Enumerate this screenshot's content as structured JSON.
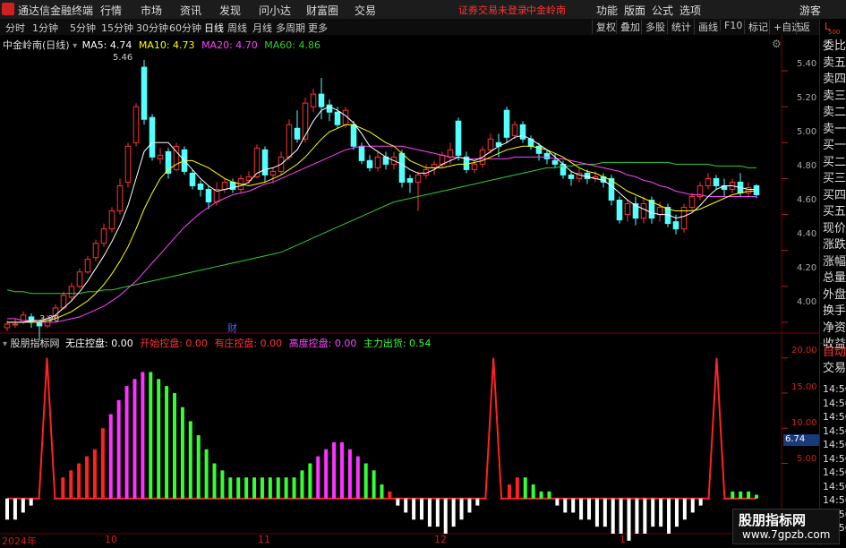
{
  "menubar": {
    "app_name": "通达信金融终端",
    "items": [
      "行情",
      "市场",
      "资讯",
      "发现",
      "问小达",
      "财富圈",
      "交易"
    ],
    "status": "证券交易未登录",
    "stock_tag": "中金岭南",
    "right_items": [
      "功能",
      "版面",
      "公式",
      "选项"
    ],
    "user": "游客"
  },
  "toolbar": {
    "periods": [
      "分时",
      "1分钟",
      "5分钟",
      "15分钟",
      "30分钟",
      "60分钟",
      "日线",
      "周线",
      "月线",
      "多周期",
      "更多"
    ],
    "active_period": "日线",
    "buttons": [
      "复权",
      "叠加",
      "多股",
      "统计",
      "画线",
      "F10",
      "标记",
      "+自选",
      "返回"
    ]
  },
  "sidebar": {
    "top_label": "L",
    "top_sub": "500",
    "items": [
      "委比",
      "卖五",
      "卖四",
      "卖三",
      "卖二",
      "卖一",
      "买一",
      "买二",
      "买三",
      "买四",
      "买五",
      "现价",
      "涨跌",
      "涨幅",
      "总量",
      "外盘",
      "换手",
      "净资",
      "收益"
    ],
    "lower_items": [
      "自动",
      "交易"
    ],
    "time_items": [
      "14:56",
      "14:56",
      "14:56",
      "14:56",
      "14:56",
      "14:56",
      "14:56",
      "14:56",
      "14:56",
      "14:56",
      "14:56"
    ]
  },
  "kline_legend": {
    "title": "中金岭南(日线)",
    "ma5": "MA5: 4.74",
    "ma10": "MA10: 4.73",
    "ma20": "MA20: 4.70",
    "ma60": "MA60: 4.86"
  },
  "indicator_legend": {
    "title": "股朋指标网",
    "items": [
      {
        "label": "无庄控盘: 0.00",
        "color": "#ffffff"
      },
      {
        "label": "开始控盘: 0.00",
        "color": "#ff3333"
      },
      {
        "label": "有庄控盘: 0.00",
        "color": "#ff3333"
      },
      {
        "label": "高度控盘: 0.00",
        "color": "#ff44ff"
      },
      {
        "label": "主力出货: 0.54",
        "color": "#33ff33"
      }
    ]
  },
  "price_axis": [
    "5.40",
    "5.20",
    "5.00",
    "4.80",
    "4.60",
    "4.40",
    "4.20",
    "4.00"
  ],
  "indicator_axis": [
    "20.00",
    "15.00",
    "10.00",
    "5.00"
  ],
  "indicator_current": "6.74",
  "annotations": {
    "high": "5.46",
    "low": "3.90",
    "finance_mark": "财"
  },
  "time_axis": [
    "2024年",
    "10",
    "11",
    "12",
    "1"
  ],
  "watermark": {
    "title": "股朋指标网",
    "url": "www.7gpzb.com"
  },
  "colors": {
    "up": "#ff3333",
    "down": "#54ffff",
    "ma5": "#ffffff",
    "ma10": "#ffff00",
    "ma20": "#ff44ff",
    "ma60": "#33cc33",
    "bg": "#000000"
  },
  "chart_data": {
    "type": "candlestick",
    "ylim": [
      3.9,
      5.5
    ],
    "candles": [
      [
        3.97,
        3.99,
        3.95,
        4.01
      ],
      [
        3.99,
        3.99,
        3.97,
        4.02
      ],
      [
        4.0,
        4.04,
        3.99,
        4.06
      ],
      [
        4.03,
        4.0,
        3.97,
        4.05
      ],
      [
        4.0,
        3.98,
        3.9,
        4.01
      ],
      [
        3.98,
        4.02,
        3.97,
        4.04
      ],
      [
        4.03,
        4.08,
        4.02,
        4.1
      ],
      [
        4.08,
        4.15,
        4.07,
        4.17
      ],
      [
        4.14,
        4.2,
        4.12,
        4.22
      ],
      [
        4.2,
        4.28,
        4.19,
        4.3
      ],
      [
        4.28,
        4.35,
        4.27,
        4.37
      ],
      [
        4.36,
        4.44,
        4.34,
        4.46
      ],
      [
        4.44,
        4.52,
        4.42,
        4.55
      ],
      [
        4.52,
        4.62,
        4.5,
        4.64
      ],
      [
        4.62,
        4.76,
        4.6,
        4.8
      ],
      [
        4.78,
        4.98,
        4.75,
        5.0
      ],
      [
        5.0,
        5.2,
        4.98,
        5.22
      ],
      [
        5.42,
        5.13,
        5.1,
        5.46
      ],
      [
        5.14,
        4.92,
        4.9,
        5.16
      ],
      [
        4.91,
        4.93,
        4.88,
        4.97
      ],
      [
        4.95,
        4.83,
        4.8,
        4.97
      ],
      [
        4.85,
        4.98,
        4.84,
        5.0
      ],
      [
        4.96,
        4.84,
        4.82,
        4.98
      ],
      [
        4.83,
        4.76,
        4.74,
        4.85
      ],
      [
        4.77,
        4.74,
        4.7,
        4.79
      ],
      [
        4.74,
        4.67,
        4.63,
        4.76
      ],
      [
        4.67,
        4.74,
        4.65,
        4.78
      ],
      [
        4.74,
        4.78,
        4.72,
        4.8
      ],
      [
        4.78,
        4.74,
        4.72,
        4.8
      ],
      [
        4.74,
        4.8,
        4.72,
        4.82
      ],
      [
        4.79,
        4.81,
        4.77,
        4.84
      ],
      [
        4.81,
        4.97,
        4.8,
        4.99
      ],
      [
        4.96,
        4.82,
        4.78,
        4.98
      ],
      [
        4.82,
        4.84,
        4.78,
        4.86
      ],
      [
        4.84,
        4.92,
        4.82,
        4.95
      ],
      [
        4.92,
        5.1,
        4.9,
        5.13
      ],
      [
        5.08,
        5.02,
        5.0,
        5.18
      ],
      [
        5.02,
        5.22,
        5.0,
        5.25
      ],
      [
        5.2,
        5.27,
        5.17,
        5.3
      ],
      [
        5.27,
        5.2,
        5.13,
        5.36
      ],
      [
        5.21,
        5.17,
        5.12,
        5.24
      ],
      [
        5.17,
        5.1,
        5.08,
        5.2
      ],
      [
        5.1,
        5.18,
        5.08,
        5.2
      ],
      [
        5.1,
        4.98,
        4.96,
        5.12
      ],
      [
        4.98,
        4.9,
        4.88,
        5.0
      ],
      [
        4.9,
        4.86,
        4.84,
        4.93
      ],
      [
        4.86,
        4.92,
        4.84,
        4.95
      ],
      [
        4.92,
        4.88,
        4.85,
        4.95
      ],
      [
        4.88,
        4.92,
        4.85,
        4.95
      ],
      [
        4.94,
        4.78,
        4.75,
        4.96
      ],
      [
        4.8,
        4.78,
        4.72,
        4.82
      ],
      [
        4.78,
        4.82,
        4.62,
        4.84
      ],
      [
        4.82,
        4.85,
        4.8,
        4.88
      ],
      [
        4.86,
        4.88,
        4.82,
        4.9
      ],
      [
        4.88,
        4.93,
        4.86,
        4.95
      ],
      [
        4.92,
        4.96,
        4.88,
        5.0
      ],
      [
        5.12,
        4.93,
        4.9,
        5.14
      ],
      [
        4.92,
        4.85,
        4.83,
        4.95
      ],
      [
        4.85,
        4.88,
        4.83,
        4.9
      ],
      [
        4.88,
        4.96,
        4.86,
        4.98
      ],
      [
        4.96,
        5.02,
        4.94,
        5.05
      ],
      [
        5.0,
        4.98,
        4.92,
        5.05
      ],
      [
        5.18,
        5.03,
        5.0,
        5.2
      ],
      [
        5.04,
        5.1,
        5.02,
        5.12
      ],
      [
        5.1,
        5.02,
        5.0,
        5.12
      ],
      [
        5.02,
        4.98,
        4.96,
        5.04
      ],
      [
        4.98,
        4.94,
        4.9,
        5.0
      ],
      [
        4.94,
        4.91,
        4.88,
        4.96
      ],
      [
        4.9,
        4.88,
        4.86,
        4.94
      ],
      [
        4.88,
        4.82,
        4.8,
        4.9
      ],
      [
        4.82,
        4.8,
        4.76,
        4.84
      ],
      [
        4.8,
        4.83,
        4.78,
        4.86
      ],
      [
        4.83,
        4.8,
        4.77,
        4.85
      ],
      [
        4.8,
        4.81,
        4.78,
        4.84
      ],
      [
        4.81,
        4.78,
        4.75,
        4.83
      ],
      [
        4.8,
        4.68,
        4.65,
        4.82
      ],
      [
        4.68,
        4.57,
        4.55,
        4.7
      ],
      [
        4.6,
        4.66,
        4.56,
        4.68
      ],
      [
        4.66,
        4.58,
        4.54,
        4.7
      ],
      [
        4.58,
        4.66,
        4.55,
        4.7
      ],
      [
        4.68,
        4.58,
        4.55,
        4.7
      ],
      [
        4.6,
        4.64,
        4.56,
        4.67
      ],
      [
        4.64,
        4.55,
        4.53,
        4.66
      ],
      [
        4.56,
        4.52,
        4.49,
        4.6
      ],
      [
        4.52,
        4.64,
        4.5,
        4.66
      ],
      [
        4.64,
        4.7,
        4.62,
        4.72
      ],
      [
        4.7,
        4.76,
        4.68,
        4.78
      ],
      [
        4.76,
        4.8,
        4.74,
        4.83
      ],
      [
        4.8,
        4.76,
        4.74,
        4.82
      ],
      [
        4.76,
        4.74,
        4.7,
        4.8
      ],
      [
        4.74,
        4.78,
        4.72,
        4.8
      ],
      [
        4.78,
        4.72,
        4.7,
        4.83
      ],
      [
        4.72,
        4.75,
        4.7,
        4.78
      ],
      [
        4.76,
        4.71,
        4.69,
        4.77
      ]
    ],
    "ma5": [
      4.0,
      4.0,
      4.0,
      4.01,
      4.01,
      4.02,
      4.04,
      4.08,
      4.12,
      4.17,
      4.23,
      4.3,
      4.37,
      4.45,
      4.54,
      4.65,
      4.8,
      4.95,
      5.0,
      5.0,
      5.0,
      4.95,
      4.9,
      4.85,
      4.8,
      4.76,
      4.73,
      4.74,
      4.75,
      4.76,
      4.78,
      4.83,
      4.85,
      4.86,
      4.88,
      4.92,
      4.96,
      5.04,
      5.12,
      5.18,
      5.2,
      5.18,
      5.15,
      5.11,
      5.05,
      4.98,
      4.95,
      4.92,
      4.9,
      4.88,
      4.85,
      4.83,
      4.83,
      4.85,
      4.88,
      4.9,
      4.92,
      4.91,
      4.9,
      4.92,
      4.95,
      4.98,
      5.0,
      5.03,
      5.04,
      5.02,
      4.99,
      4.96,
      4.92,
      4.88,
      4.84,
      4.82,
      4.81,
      4.8,
      4.79,
      4.76,
      4.72,
      4.68,
      4.65,
      4.63,
      4.61,
      4.6,
      4.6,
      4.58,
      4.59,
      4.61,
      4.65,
      4.7,
      4.74,
      4.76,
      4.76,
      4.75,
      4.74,
      4.74
    ],
    "ma10": [
      4.0,
      4.0,
      4.0,
      4.0,
      4.0,
      4.01,
      4.02,
      4.04,
      4.06,
      4.09,
      4.12,
      4.16,
      4.21,
      4.27,
      4.34,
      4.42,
      4.52,
      4.63,
      4.72,
      4.8,
      4.85,
      4.88,
      4.9,
      4.9,
      4.88,
      4.86,
      4.83,
      4.8,
      4.78,
      4.77,
      4.76,
      4.77,
      4.78,
      4.8,
      4.82,
      4.85,
      4.88,
      4.92,
      4.97,
      5.02,
      5.06,
      5.08,
      5.1,
      5.1,
      5.08,
      5.06,
      5.03,
      5.0,
      4.98,
      4.94,
      4.9,
      4.88,
      4.86,
      4.86,
      4.86,
      4.87,
      4.88,
      4.88,
      4.89,
      4.9,
      4.92,
      4.94,
      4.96,
      4.97,
      4.98,
      4.98,
      4.97,
      4.96,
      4.94,
      4.92,
      4.89,
      4.86,
      4.84,
      4.83,
      4.81,
      4.79,
      4.76,
      4.73,
      4.71,
      4.69,
      4.67,
      4.65,
      4.63,
      4.62,
      4.62,
      4.62,
      4.63,
      4.65,
      4.67,
      4.69,
      4.71,
      4.72,
      4.73,
      4.73
    ],
    "ma20": [
      4.02,
      4.02,
      4.01,
      4.01,
      4.0,
      4.0,
      4.0,
      4.01,
      4.02,
      4.03,
      4.05,
      4.07,
      4.09,
      4.12,
      4.15,
      4.19,
      4.23,
      4.28,
      4.33,
      4.38,
      4.43,
      4.48,
      4.53,
      4.57,
      4.61,
      4.64,
      4.67,
      4.69,
      4.71,
      4.72,
      4.73,
      4.75,
      4.77,
      4.78,
      4.8,
      4.82,
      4.84,
      4.86,
      4.88,
      4.9,
      4.92,
      4.94,
      4.96,
      4.97,
      4.98,
      4.98,
      4.98,
      4.98,
      4.98,
      4.98,
      4.97,
      4.96,
      4.95,
      4.94,
      4.93,
      4.92,
      4.92,
      4.91,
      4.91,
      4.91,
      4.91,
      4.91,
      4.91,
      4.92,
      4.92,
      4.92,
      4.92,
      4.92,
      4.91,
      4.91,
      4.9,
      4.89,
      4.88,
      4.87,
      4.86,
      4.85,
      4.84,
      4.82,
      4.81,
      4.79,
      4.78,
      4.76,
      4.75,
      4.73,
      4.72,
      4.71,
      4.71,
      4.7,
      4.7,
      4.7,
      4.7,
      4.7,
      4.7,
      4.7
    ],
    "ma60": [
      4.18,
      4.17,
      4.17,
      4.16,
      4.16,
      4.16,
      4.16,
      4.16,
      4.16,
      4.16,
      4.17,
      4.17,
      4.18,
      4.18,
      4.19,
      4.2,
      4.21,
      4.22,
      4.23,
      4.24,
      4.25,
      4.26,
      4.27,
      4.28,
      4.29,
      4.3,
      4.31,
      4.32,
      4.33,
      4.34,
      4.35,
      4.36,
      4.37,
      4.38,
      4.39,
      4.41,
      4.43,
      4.45,
      4.47,
      4.49,
      4.51,
      4.53,
      4.55,
      4.57,
      4.59,
      4.61,
      4.63,
      4.65,
      4.67,
      4.68,
      4.69,
      4.7,
      4.71,
      4.72,
      4.73,
      4.74,
      4.75,
      4.76,
      4.77,
      4.78,
      4.79,
      4.8,
      4.81,
      4.82,
      4.83,
      4.84,
      4.85,
      4.86,
      4.86,
      4.87,
      4.87,
      4.88,
      4.88,
      4.88,
      4.89,
      4.89,
      4.89,
      4.89,
      4.89,
      4.89,
      4.89,
      4.89,
      4.89,
      4.88,
      4.88,
      4.88,
      4.88,
      4.88,
      4.87,
      4.87,
      4.87,
      4.87,
      4.86,
      4.86
    ],
    "indicator": {
      "ylim": [
        -5,
        22
      ],
      "values": [
        0,
        0,
        0,
        0,
        0,
        0,
        0,
        0,
        0,
        0,
        0,
        0,
        0,
        0,
        0,
        0,
        0,
        0,
        0,
        0,
        0,
        0,
        0,
        0,
        0,
        0,
        0,
        0,
        0,
        0,
        0,
        0,
        0,
        0,
        0,
        0,
        0,
        0,
        0,
        0,
        0,
        0,
        0,
        0,
        0,
        0,
        0,
        0,
        0,
        0,
        0,
        0,
        0,
        0,
        0,
        0,
        0,
        0,
        0,
        0,
        0,
        0,
        0,
        0,
        0,
        0,
        0,
        0,
        0,
        0,
        0,
        0,
        0,
        0,
        0,
        0,
        0,
        0,
        0,
        0,
        0,
        0,
        0,
        0,
        0,
        0,
        0,
        0,
        0,
        0,
        0,
        0,
        0,
        0
      ],
      "bars": [
        -3,
        -3,
        -2,
        -1,
        0,
        20,
        0,
        3,
        4,
        5,
        6,
        7,
        10,
        12,
        14,
        16,
        17,
        18,
        18,
        17,
        16,
        15,
        13,
        11,
        9,
        7,
        5,
        4,
        3,
        3,
        3,
        3,
        3,
        3,
        3,
        3,
        3,
        4,
        5,
        6,
        7,
        8,
        8,
        7,
        6,
        5,
        4,
        2,
        1,
        -1,
        -2,
        -3,
        -3,
        -4,
        -4,
        -5,
        -4,
        -3,
        -2,
        -1,
        0,
        20,
        0,
        2,
        3,
        3,
        2,
        1,
        1,
        -1,
        -2,
        -2,
        -3,
        -3,
        -4,
        -4,
        -5,
        -5,
        -6,
        -5,
        -5,
        -4,
        -4,
        -5,
        -4,
        -3,
        -2,
        -1,
        0,
        20,
        0,
        1,
        1,
        1,
        0.54
      ]
    }
  }
}
